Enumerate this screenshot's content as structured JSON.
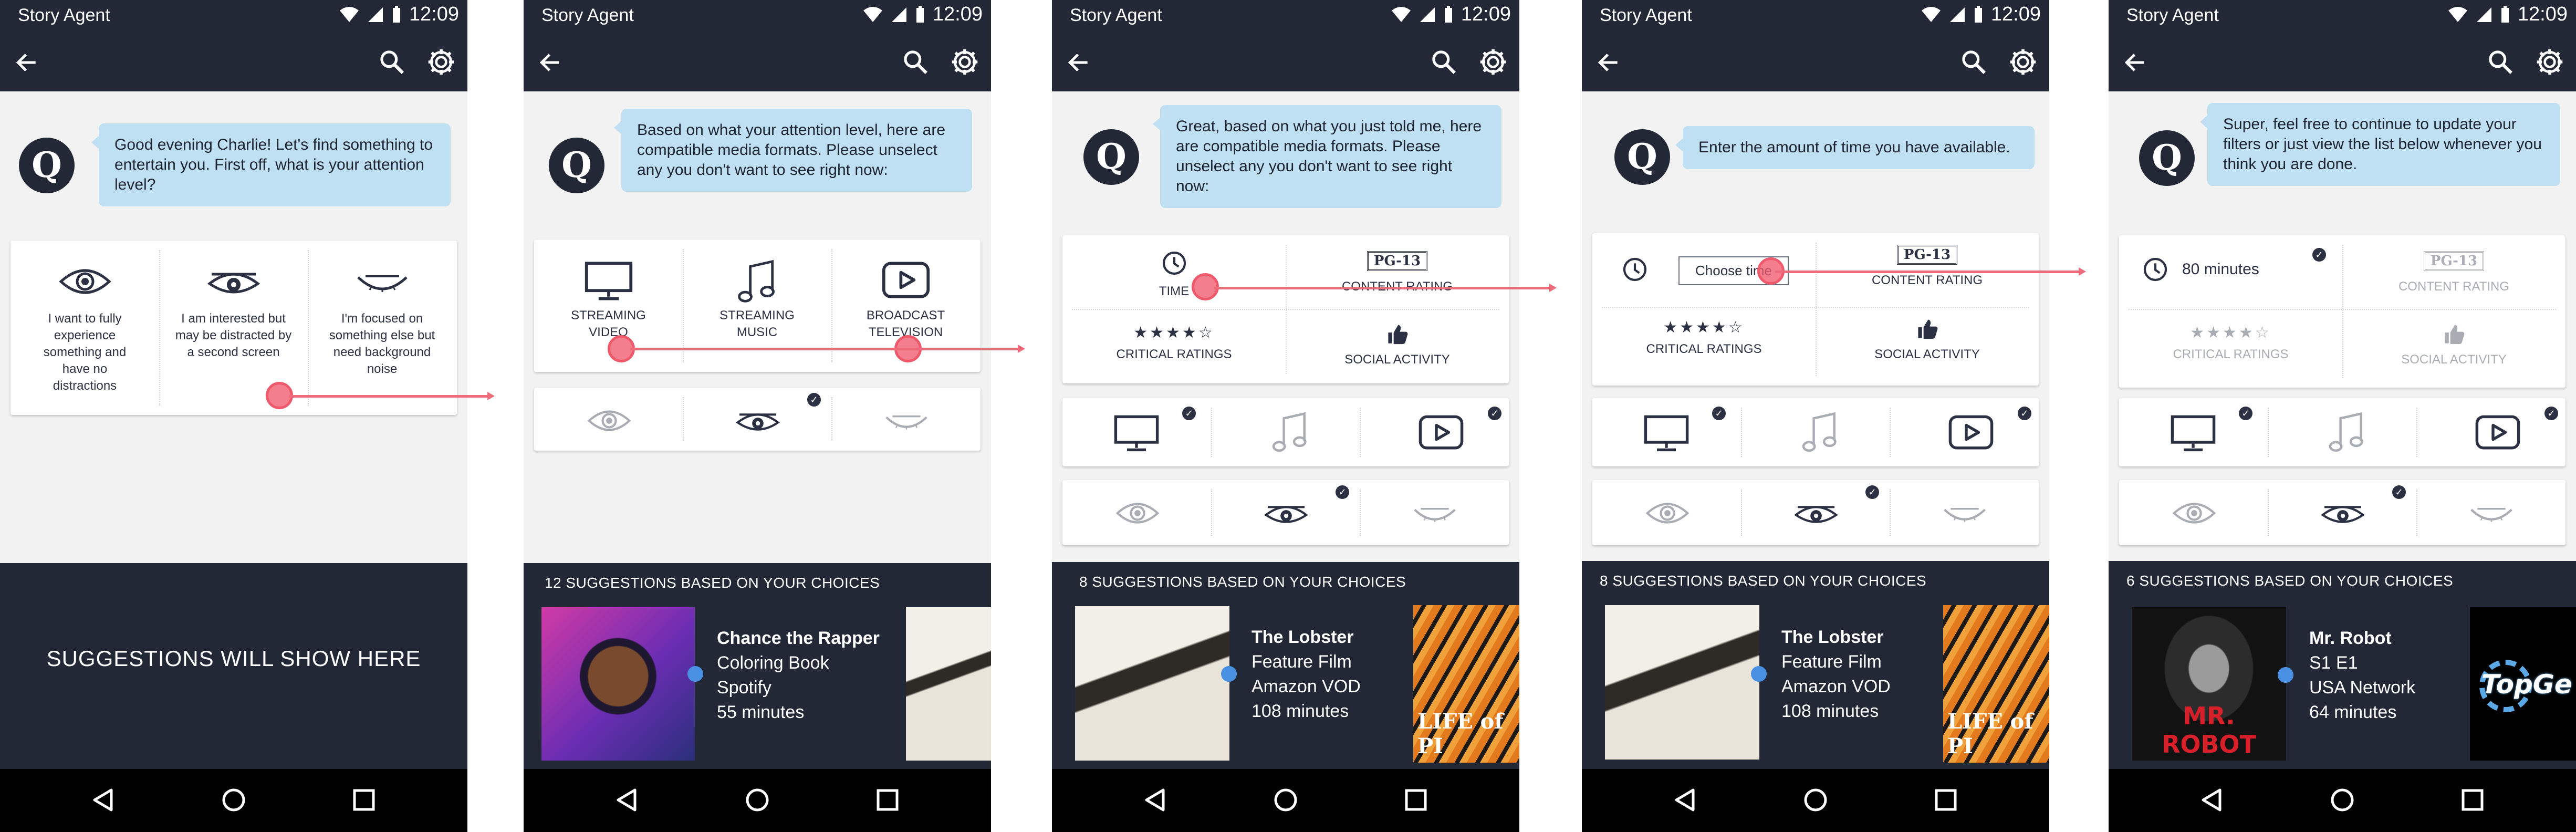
{
  "status": {
    "app_name": "Story Agent",
    "time": "12:09"
  },
  "agent": {
    "avatar_letter": "Q"
  },
  "colors": {
    "bar": "#232836",
    "bubble": "#bfe0f3",
    "touch": "#ee5a6c",
    "dot": "#4a90e2"
  },
  "screens": [
    {
      "message": "Good evening Charlie!  Let's find something to entertain you.  First off, what is your attention level?",
      "attention_options": [
        {
          "icon": "eye-open-icon",
          "label": "I want to fully experience something and have no distractions"
        },
        {
          "icon": "eye-half-icon",
          "label": "I am interested but may be distracted by a second screen"
        },
        {
          "icon": "eye-closed-icon",
          "label": "I'm focused on something else but need background noise"
        }
      ],
      "placeholder": "SUGGESTIONS WILL SHOW HERE"
    },
    {
      "message": "Based on what your attention level, here are compatible media formats.  Please unselect any you don't want to see right now:",
      "formats": [
        {
          "icon": "monitor-icon",
          "label": "STREAMING VIDEO"
        },
        {
          "icon": "music-note-icon",
          "label": "STREAMING MUSIC"
        },
        {
          "icon": "play-button-icon",
          "label": "BROADCAST TELEVISION"
        }
      ],
      "suggestions_header": "12 SUGGESTIONS BASED ON YOUR CHOICES",
      "suggestion": {
        "title": "Chance the Rapper",
        "line1": "Coloring Book",
        "line2": "Spotify",
        "line3": "55 minutes"
      }
    },
    {
      "message": "Great, based on what you just told me, here are compatible media formats.  Please unselect any you don't want to see right now:",
      "filters": {
        "time": "TIME",
        "rating_badge": "PG-13",
        "content_rating": "CONTENT RATING",
        "critical": "CRITICAL RATINGS",
        "social": "SOCIAL ACTIVITY",
        "stars": "★★★★☆"
      },
      "suggestions_header": "8 SUGGESTIONS BASED ON YOUR CHOICES",
      "suggestion": {
        "title": "The Lobster",
        "line1": "Feature Film",
        "line2": "Amazon VOD",
        "line3": "108 minutes"
      }
    },
    {
      "message": "Enter the amount of time you have available.",
      "time_button": "Choose time",
      "filters": {
        "rating_badge": "PG-13",
        "content_rating": "CONTENT RATING",
        "critical": "CRITICAL RATINGS",
        "social": "SOCIAL ACTIVITY",
        "stars": "★★★★☆"
      },
      "suggestions_header": "8 SUGGESTIONS BASED ON YOUR CHOICES",
      "suggestion": {
        "title": "The Lobster",
        "line1": "Feature Film",
        "line2": "Amazon VOD",
        "line3": "108 minutes"
      }
    },
    {
      "message": "Super, feel free to continue to update your filters or just view the list below whenever you think you are done.",
      "filters": {
        "time_value": "80 minutes",
        "rating_badge": "PG-13",
        "content_rating": "CONTENT RATING",
        "critical": "CRITICAL RATINGS",
        "social": "SOCIAL ACTIVITY",
        "stars": "★★★★☆"
      },
      "suggestions_header": "6 SUGGESTIONS BASED ON YOUR CHOICES",
      "suggestion": {
        "title": "Mr. Robot",
        "line1": "S1 E1",
        "line2": "USA Network",
        "line3": "64 minutes",
        "poster_text": "MR. ROBOT"
      }
    }
  ],
  "posters": {
    "life_of_pi": "LIFE of PI",
    "top_gear": "TopGe"
  }
}
